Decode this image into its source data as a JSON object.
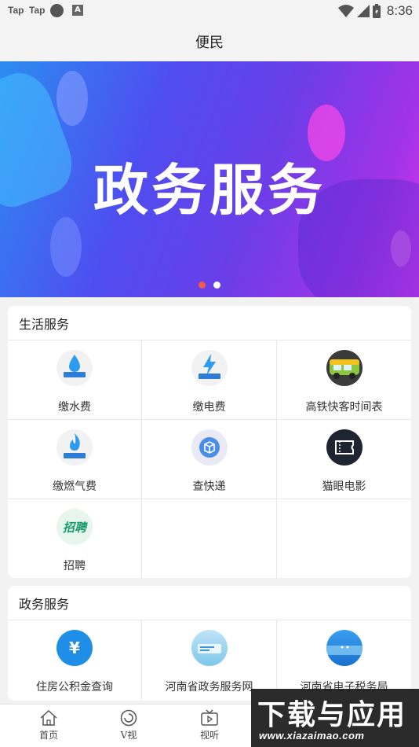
{
  "status_bar": {
    "app1": "Tap",
    "app2": "Tap",
    "time": "8:36"
  },
  "header": {
    "title": "便民"
  },
  "banner": {
    "headline": "政务服务",
    "slide_count": 2,
    "active_slide": 1,
    "colors": {
      "start": "#2c8cf0",
      "mid": "#6a3ee8",
      "end": "#d438ef"
    }
  },
  "life_services": {
    "title": "生活服务",
    "items": [
      {
        "label": "缴水费",
        "icon": "water-drop-icon"
      },
      {
        "label": "缴电费",
        "icon": "lightning-icon"
      },
      {
        "label": "高铁快客时间表",
        "icon": "bus-icon"
      },
      {
        "label": "缴燃气费",
        "icon": "flame-icon"
      },
      {
        "label": "查快递",
        "icon": "package-icon"
      },
      {
        "label": "猫眼电影",
        "icon": "ticket-icon"
      },
      {
        "label": "招聘",
        "icon": "recruit-icon",
        "badge_text": "招聘"
      }
    ]
  },
  "gov_services": {
    "title": "政务服务",
    "items": [
      {
        "label": "住房公积金查询",
        "icon": "housing-fund-icon",
        "badge_text": "¥"
      },
      {
        "label": "河南省政务服务网",
        "icon": "gov-web-icon"
      },
      {
        "label": "河南省电子税务局",
        "icon": "tax-bureau-icon"
      }
    ]
  },
  "bottom_nav": {
    "items": [
      {
        "label": "首页",
        "icon": "home-icon"
      },
      {
        "label": "V视",
        "icon": "v-video-icon"
      },
      {
        "label": "视听",
        "icon": "tv-icon"
      }
    ]
  },
  "watermark": {
    "title": "下载与应用",
    "url": "www.xiazaimao.com"
  }
}
